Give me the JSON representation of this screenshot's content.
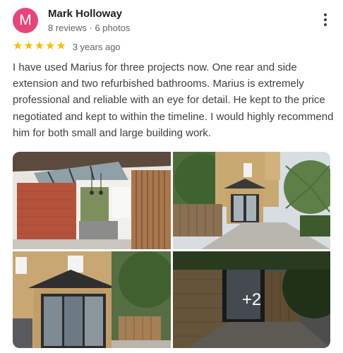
{
  "reviewer": {
    "avatar_letter": "M",
    "name": "Mark Holloway",
    "meta": "8 reviews · 6 photos",
    "avatar_color": "#e6457a"
  },
  "rating": {
    "stars": 5,
    "max_stars": 5,
    "star_color": "#fbbc04",
    "time": "3 years ago"
  },
  "review": {
    "text": "I have used Marius for three projects now. One rear and side extension and two refurbished bathrooms. Marius is extremely professional and reliable with an eye for detail. He kept to the price negotiated and kept to within the timeline. I would highly recommend him for both small and large building work."
  },
  "photos": {
    "extra_count_label": "+2"
  },
  "icons": {
    "menu": "more-vert-icon",
    "star": "star-icon"
  }
}
